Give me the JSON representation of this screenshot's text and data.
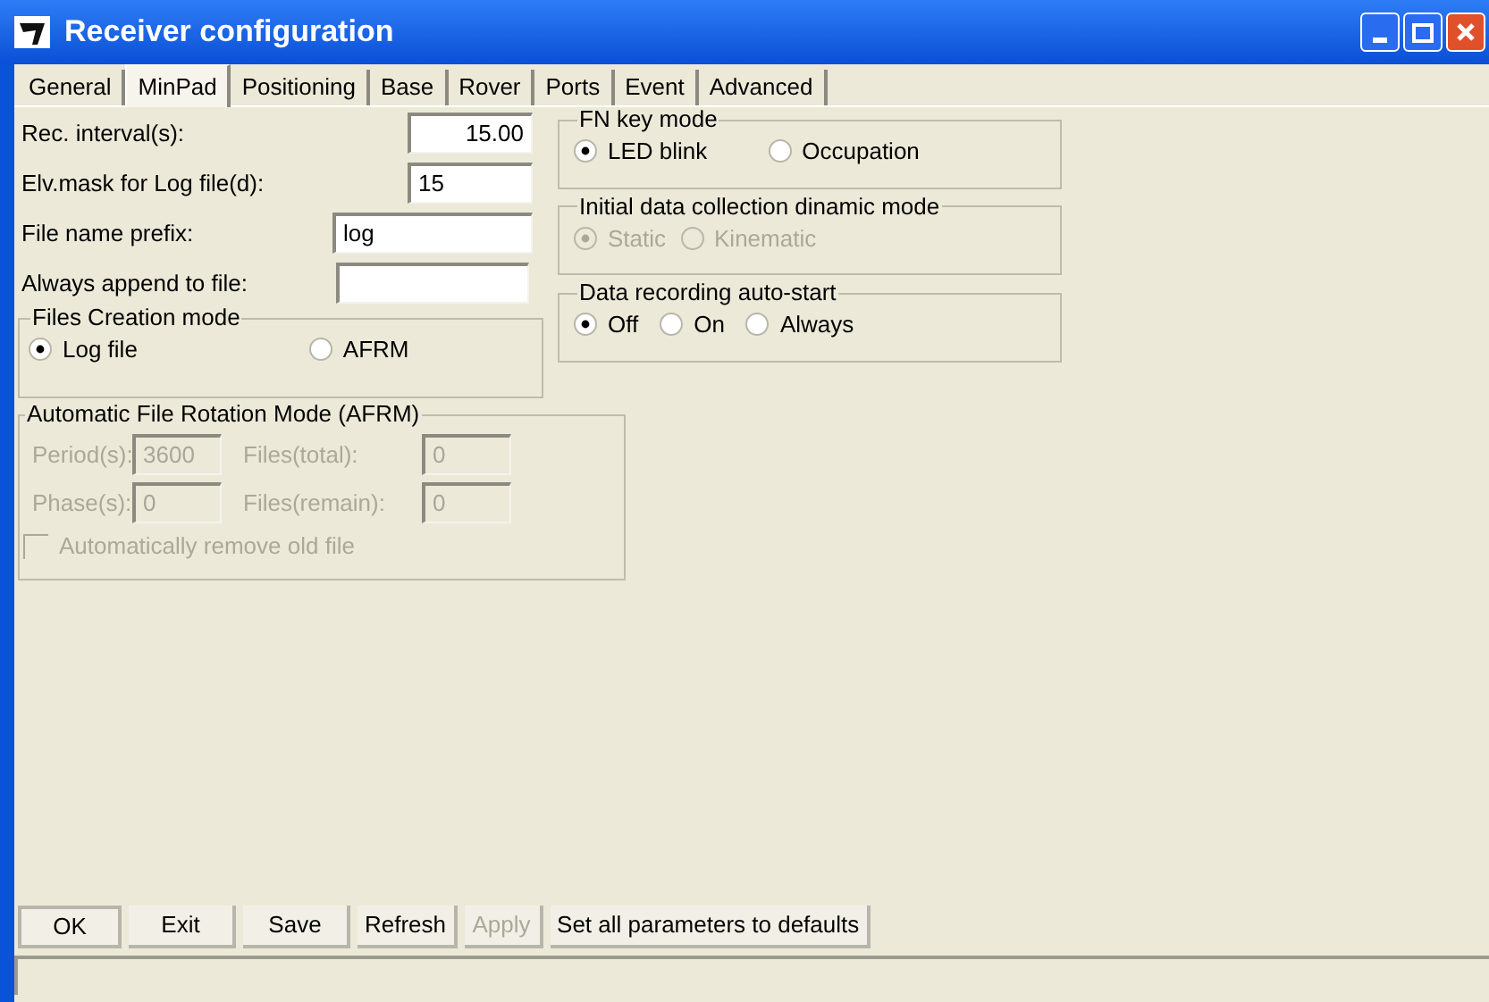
{
  "window": {
    "title": "Receiver configuration"
  },
  "tabs": [
    {
      "label": "General",
      "selected": false
    },
    {
      "label": "MinPad",
      "selected": true
    },
    {
      "label": "Positioning",
      "selected": false
    },
    {
      "label": "Base",
      "selected": false
    },
    {
      "label": "Rover",
      "selected": false
    },
    {
      "label": "Ports",
      "selected": false
    },
    {
      "label": "Event",
      "selected": false
    },
    {
      "label": "Advanced",
      "selected": false
    }
  ],
  "fields": [
    {
      "label": "Rec. interval(s):",
      "value": "15.00"
    },
    {
      "label": "Elv.mask for Log file(d):",
      "value": "15"
    },
    {
      "label": "File name prefix:",
      "value": "log"
    },
    {
      "label": "Always append to file:"
    }
  ],
  "files_creation_mode": {
    "title": "Files Creation mode",
    "options": [
      {
        "label": "Log file",
        "selected": true
      },
      {
        "label": "AFRM",
        "selected": false
      }
    ]
  },
  "afrm": {
    "title": "Automatic File Rotation Mode (AFRM)",
    "disabled": true,
    "fields": [
      {
        "label": "Period(s):",
        "value": "3600"
      },
      {
        "label": "Files(total):",
        "value": "0"
      },
      {
        "label": "Phase(s):",
        "value": "0"
      },
      {
        "label": "Files(remain):",
        "value": "0"
      }
    ],
    "checkbox": {
      "label": "Automatically remove old file",
      "checked": false
    }
  },
  "radio_groups": [
    {
      "title": "FN key mode",
      "disabled": false,
      "options": [
        {
          "label": "LED blink",
          "selected": true
        },
        {
          "label": "Occupation",
          "selected": false
        }
      ]
    },
    {
      "title": "Initial data collection dinamic mode",
      "disabled": true,
      "options": [
        {
          "label": "Static",
          "selected": true
        },
        {
          "label": "Kinematic",
          "selected": false
        }
      ]
    },
    {
      "title": "Data recording auto-start",
      "disabled": false,
      "options": [
        {
          "label": "Off",
          "selected": true
        },
        {
          "label": "On",
          "selected": false
        },
        {
          "label": "Always",
          "selected": false
        }
      ]
    }
  ],
  "buttons": [
    {
      "label": "OK",
      "disabled": false,
      "default": true
    },
    {
      "label": "Exit",
      "disabled": false,
      "default": false
    },
    {
      "label": "Save",
      "disabled": false,
      "default": false
    },
    {
      "label": "Refresh",
      "disabled": false,
      "default": false
    },
    {
      "label": "Apply",
      "disabled": true,
      "default": false
    },
    {
      "label": "Set all parameters to defaults",
      "disabled": false,
      "default": false
    }
  ]
}
